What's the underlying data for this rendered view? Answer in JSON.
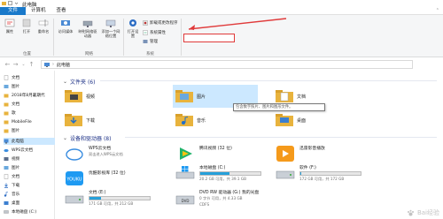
{
  "window": {
    "title": "此电脑"
  },
  "tabs": [
    {
      "label": "文件"
    },
    {
      "label": "计算机"
    },
    {
      "label": "查看"
    }
  ],
  "ribbon": {
    "location_group": {
      "label": "位置",
      "buttons": [
        {
          "label": "属性",
          "icon": "properties-icon"
        },
        {
          "label": "打开",
          "icon": "open-icon"
        },
        {
          "label": "重命名",
          "icon": "rename-icon"
        }
      ]
    },
    "network_group": {
      "label": "网络",
      "buttons": [
        {
          "label": "访问媒体",
          "icon": "media-icon"
        },
        {
          "label": "映射网络驱动器",
          "icon": "map-drive-icon"
        },
        {
          "label": "添加一个网络位置",
          "icon": "network-location-icon"
        }
      ]
    },
    "system_group": {
      "label": "系统",
      "open_settings": "打开设置",
      "uninstall": "卸载或更改程序",
      "system_properties": "系统属性",
      "manage": "管理"
    }
  },
  "address": {
    "path": "此电脑"
  },
  "sidebar": {
    "items": [
      {
        "label": "文档"
      },
      {
        "label": "图片"
      },
      {
        "label": "2018年8月暑期代"
      },
      {
        "label": "文档"
      },
      {
        "label": "歌"
      },
      {
        "label": "MobileFile"
      },
      {
        "label": "图片"
      },
      {
        "label": "此电脑"
      },
      {
        "label": "WPS云文档"
      },
      {
        "label": "视频"
      },
      {
        "label": "图片"
      },
      {
        "label": "文档"
      },
      {
        "label": "下载"
      },
      {
        "label": "音乐"
      },
      {
        "label": "桌面"
      },
      {
        "label": "本地磁盘 (C:)"
      }
    ]
  },
  "folders_section": {
    "title": "文件夹 (6)"
  },
  "folders": [
    {
      "label": "视频"
    },
    {
      "label": "图片"
    },
    {
      "label": "文档"
    },
    {
      "label": "下载"
    },
    {
      "label": "音乐"
    },
    {
      "label": "桌面"
    }
  ],
  "tooltip": {
    "text": "包含数字照片、图片和图形文件。"
  },
  "drives_section": {
    "title": "设备和驱动器 (8)"
  },
  "drives": [
    {
      "name": "WPS云文档",
      "sub": "双击进入WPS云文档",
      "has_bar": false
    },
    {
      "name": "腾讯视频 (32 位)",
      "sub": "",
      "has_bar": false
    },
    {
      "name": "迅雷影音播放",
      "sub": "",
      "has_bar": false
    },
    {
      "name": "优酷影视库 (32 位)",
      "sub": "",
      "has_bar": false
    },
    {
      "name": "本地磁盘 (C:)",
      "sub": "20.2 GB 可用，共 39.1 GB",
      "has_bar": true,
      "fill": 0.48
    },
    {
      "name": "软件 (F:)",
      "sub": "172 GB 可用，共 172 GB",
      "has_bar": true,
      "fill": 0.02
    },
    {
      "name": "文档 (E:)",
      "sub": "171 GB 可用，共 212 GB",
      "has_bar": true,
      "fill": 0.19
    },
    {
      "name": "DVD RW 驱动器 (G:) 我的光盘",
      "sub": "0 字节 可用，共 4.33 GB",
      "sub2": "CDFS",
      "has_bar": false
    }
  ],
  "watermark": {
    "text": "Bai经验"
  },
  "colors": {
    "accent": "#1979ca",
    "selection": "#cce8ff",
    "highlight": "#e03a3a",
    "bar": "#26a0da"
  }
}
